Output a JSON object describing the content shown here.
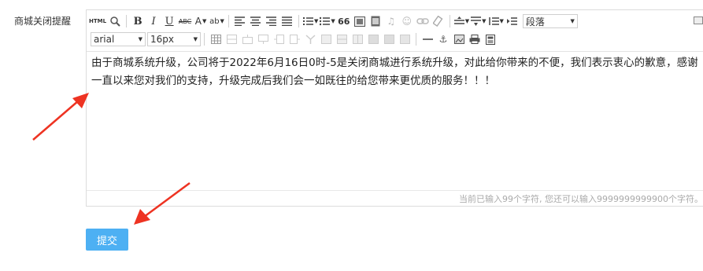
{
  "field_label": "商城关闭提醒",
  "toolbar": {
    "html_label": "HTML",
    "bold": "B",
    "italic": "I",
    "underline": "U",
    "strike": "ABC",
    "font_color": "A",
    "highlight": "ab",
    "quote": "66",
    "paragraph_select": "段落",
    "font_family_select": "arial",
    "font_size_select": "16px"
  },
  "content": {
    "text": "由于商城系统升级，公司将于2022年6月16日0时-5是关闭商城进行系统升级，对此给你带来的不便，我们表示衷心的歉意，感谢一直以来您对我们的支持，升级完成后我们会一如既往的给您带来更优质的服务！！！"
  },
  "status": {
    "word_count": "当前已输入99个字符, 您还可以输入9999999999900个字符。"
  },
  "submit_label": "提交",
  "colors": {
    "submit_bg": "#4db0f3",
    "arrow": "#ee3322"
  }
}
